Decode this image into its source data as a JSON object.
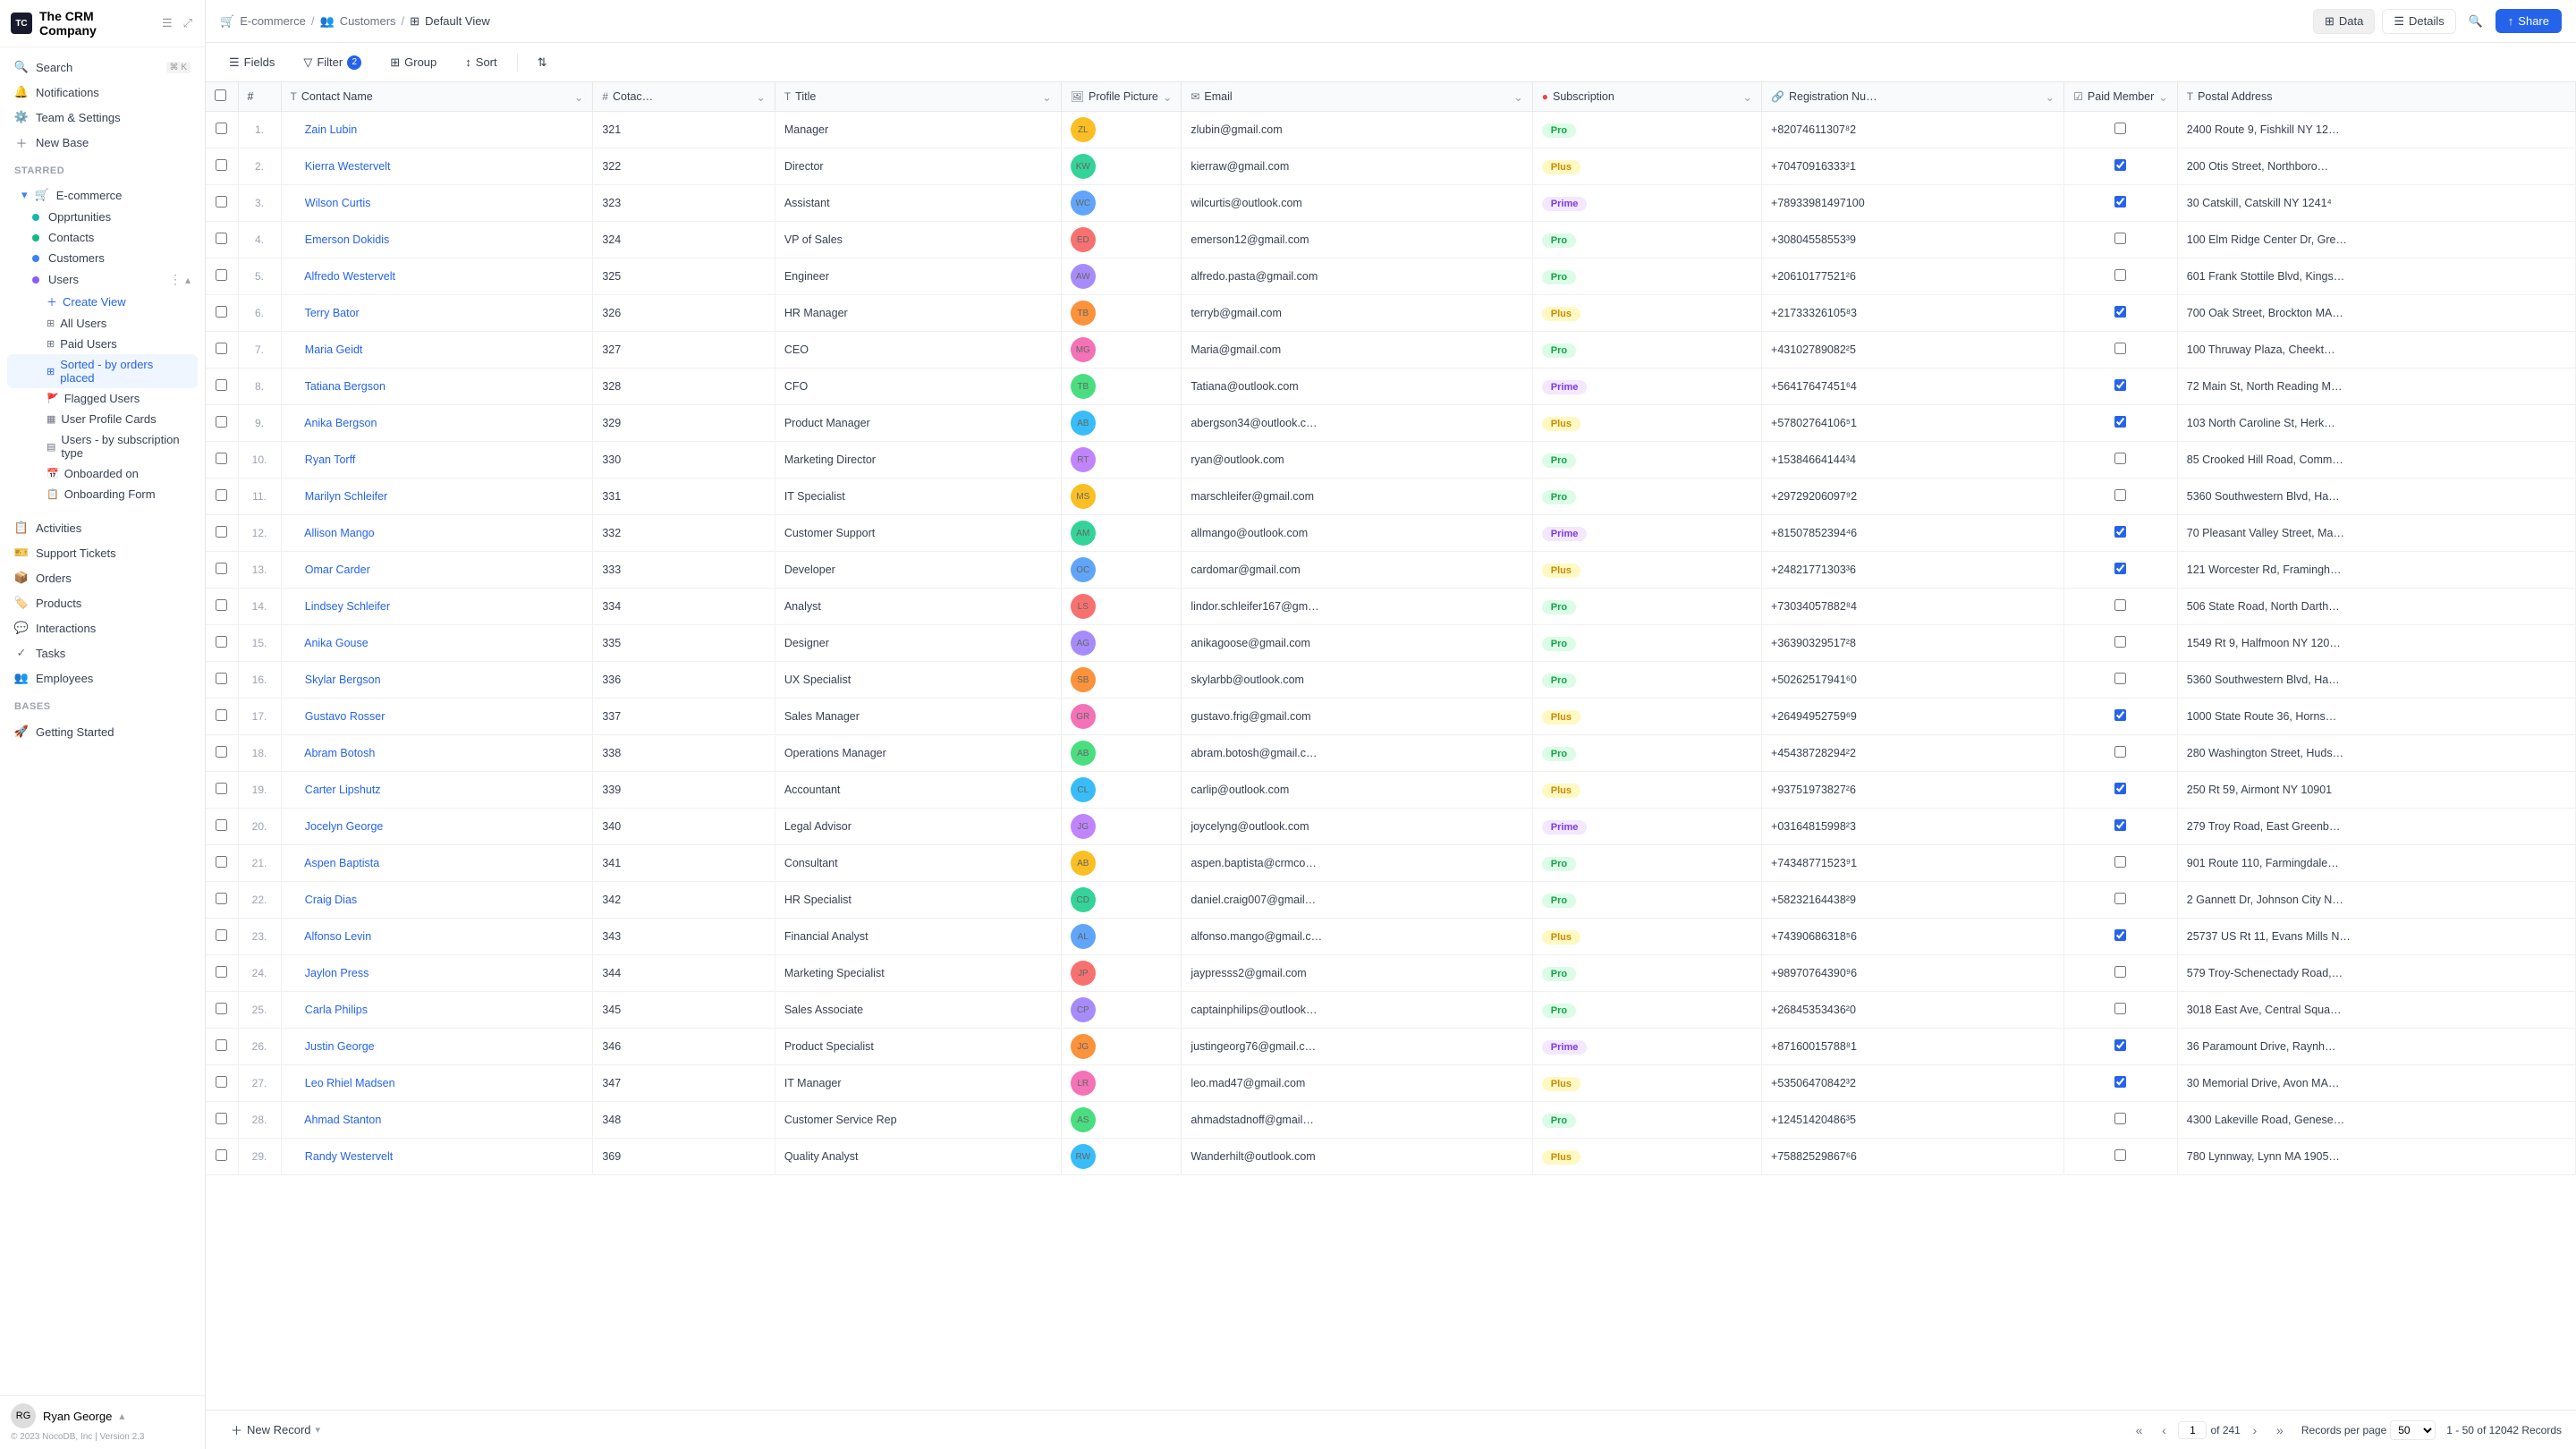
{
  "company": {
    "name": "The CRM Company",
    "logo_text": "TC"
  },
  "sidebar": {
    "top_items": [
      {
        "id": "search",
        "label": "Search",
        "hint": "⌘ K",
        "icon": "🔍"
      },
      {
        "id": "notifications",
        "label": "Notifications",
        "icon": "🔔"
      },
      {
        "id": "team-settings",
        "label": "Team & Settings",
        "icon": "⚙️"
      },
      {
        "id": "new-base",
        "label": "New Base",
        "icon": "+"
      }
    ],
    "starred_label": "Starred",
    "starred_items": [
      {
        "id": "ecommerce",
        "label": "E-commerce",
        "icon": "🛒",
        "dot": "blue"
      }
    ],
    "ecommerce_children": [
      {
        "id": "opportunities",
        "label": "Opprtunities",
        "dot": "teal"
      },
      {
        "id": "contacts",
        "label": "Contacts",
        "dot": "green"
      },
      {
        "id": "customers",
        "label": "Customers",
        "dot": "blue"
      },
      {
        "id": "users",
        "label": "Users",
        "dot": "purple",
        "active": true
      }
    ],
    "users_children": [
      {
        "id": "create-view",
        "label": "Create View"
      },
      {
        "id": "all-users",
        "label": "All Users"
      },
      {
        "id": "paid-users",
        "label": "Paid Users"
      },
      {
        "id": "sorted-by-orders",
        "label": "Sorted - by orders placed",
        "active": true
      },
      {
        "id": "flagged-users",
        "label": "Flagged Users"
      },
      {
        "id": "user-profile-cards",
        "label": "User Profile Cards"
      },
      {
        "id": "users-by-subscription",
        "label": "Users - by subscription type"
      },
      {
        "id": "onboarded-on",
        "label": "Onboarded on"
      },
      {
        "id": "onboarding-form",
        "label": "Onboarding Form"
      }
    ],
    "bottom_items": [
      {
        "id": "activities",
        "label": "Activities",
        "icon": "📋"
      },
      {
        "id": "support-tickets",
        "label": "Support Tickets",
        "icon": "🎫"
      },
      {
        "id": "orders",
        "label": "Orders",
        "icon": "📦"
      },
      {
        "id": "products",
        "label": "Products",
        "icon": "🏷️"
      },
      {
        "id": "interactions",
        "label": "Interactions",
        "icon": "💬"
      },
      {
        "id": "tasks",
        "label": "Tasks",
        "icon": "✓"
      },
      {
        "id": "employees",
        "label": "Employees",
        "icon": "👥"
      }
    ],
    "bases_label": "Bases",
    "bases_items": [
      {
        "id": "getting-started",
        "label": "Getting Started",
        "icon": "🚀"
      }
    ],
    "user": {
      "name": "Ryan George",
      "avatar": "RG"
    },
    "copyright": "© 2023 NocoDB, Inc | Version 2.3"
  },
  "topbar": {
    "breadcrumb": [
      {
        "label": "E-commerce",
        "link": true
      },
      {
        "label": "Customers",
        "link": true
      },
      {
        "label": "Default View",
        "link": false
      }
    ],
    "tabs": [
      {
        "id": "data",
        "label": "Data",
        "active": true
      },
      {
        "id": "details",
        "label": "Details",
        "active": false
      }
    ],
    "share_label": "Share"
  },
  "toolbar": {
    "fields_label": "Fields",
    "filter_label": "Filter",
    "filter_count": "2",
    "group_label": "Group",
    "sort_label": "Sort"
  },
  "table": {
    "columns": [
      {
        "id": "num",
        "label": "#",
        "icon": ""
      },
      {
        "id": "contact-name",
        "label": "Contact Name",
        "icon": "T"
      },
      {
        "id": "cotac",
        "label": "Cotac…",
        "icon": "#"
      },
      {
        "id": "title",
        "label": "Title",
        "icon": "T"
      },
      {
        "id": "profile-picture",
        "label": "Profile Picture",
        "icon": "🖼"
      },
      {
        "id": "email",
        "label": "Email",
        "icon": "✉"
      },
      {
        "id": "subscription",
        "label": "Subscription",
        "icon": "●"
      },
      {
        "id": "registration-nu",
        "label": "Registration Nu…",
        "icon": "🔗"
      },
      {
        "id": "paid-member",
        "label": "Paid Member",
        "icon": "☑"
      },
      {
        "id": "postal-address",
        "label": "Postal Address",
        "icon": "T"
      }
    ],
    "rows": [
      {
        "num": 1,
        "name": "Zain Lubin",
        "cotac": 321,
        "title": "Manager",
        "email": "zlubin@gmail.com",
        "subscription": "Pro",
        "reg": "+82074611307⁸2",
        "paid": false,
        "address": "2400 Route 9, Fishkill NY 12…"
      },
      {
        "num": 2,
        "name": "Kierra Westervelt",
        "cotac": 322,
        "title": "Director",
        "email": "kierraw@gmail.com",
        "subscription": "Plus",
        "reg": "+70470916333²1",
        "paid": true,
        "address": "200 Otis Street, Northboro…"
      },
      {
        "num": 3,
        "name": "Wilson Curtis",
        "cotac": 323,
        "title": "Assistant",
        "email": "wilcurtis@outlook.com",
        "subscription": "Prime",
        "reg": "+78933981497100",
        "paid": true,
        "address": "30 Catskill, Catskill NY 1241⁴"
      },
      {
        "num": 4,
        "name": "Emerson Dokidis",
        "cotac": 324,
        "title": "VP of Sales",
        "email": "emerson12@gmail.com",
        "subscription": "Pro",
        "reg": "+30804558553³9",
        "paid": false,
        "address": "100 Elm Ridge Center Dr, Gre…"
      },
      {
        "num": 5,
        "name": "Alfredo Westervelt",
        "cotac": 325,
        "title": "Engineer",
        "email": "alfredo.pasta@gmail.com",
        "subscription": "Pro",
        "reg": "+20610177521²6",
        "paid": false,
        "address": "601 Frank Stottile Blvd, Kings…"
      },
      {
        "num": 6,
        "name": "Terry Bator",
        "cotac": 326,
        "title": "HR Manager",
        "email": "terryb@gmail.com",
        "subscription": "Plus",
        "reg": "+21733326105⁸3",
        "paid": true,
        "address": "700 Oak Street, Brockton MA…"
      },
      {
        "num": 7,
        "name": "Maria Geidt",
        "cotac": 327,
        "title": "CEO",
        "email": "Maria@gmail.com",
        "subscription": "Pro",
        "reg": "+43102789082²5",
        "paid": false,
        "address": "100 Thruway Plaza, Cheekt…"
      },
      {
        "num": 8,
        "name": "Tatiana Bergson",
        "cotac": 328,
        "title": "CFO",
        "email": "Tatiana@outlook.com",
        "subscription": "Prime",
        "reg": "+56417647451⁶4",
        "paid": true,
        "address": "72 Main St, North Reading M…"
      },
      {
        "num": 9,
        "name": "Anika Bergson",
        "cotac": 329,
        "title": "Product Manager",
        "email": "abergson34@outlook.c…",
        "subscription": "Plus",
        "reg": "+57802764106⁵1",
        "paid": true,
        "address": "103 North Caroline St, Herk…"
      },
      {
        "num": 10,
        "name": "Ryan Torff",
        "cotac": 330,
        "title": "Marketing Director",
        "email": "ryan@outlook.com",
        "subscription": "Pro",
        "reg": "+15384664144³4",
        "paid": false,
        "address": "85 Crooked Hill Road, Comm…"
      },
      {
        "num": 11,
        "name": "Marilyn Schleifer",
        "cotac": 331,
        "title": "IT Specialist",
        "email": "marschleifer@gmail.com",
        "subscription": "Pro",
        "reg": "+29729206097⁹2",
        "paid": false,
        "address": "5360 Southwestern Blvd, Ha…"
      },
      {
        "num": 12,
        "name": "Allison Mango",
        "cotac": 332,
        "title": "Customer Support",
        "email": "allmango@outlook.com",
        "subscription": "Prime",
        "reg": "+81507852394⁴6",
        "paid": true,
        "address": "70 Pleasant Valley Street, Ma…"
      },
      {
        "num": 13,
        "name": "Omar Carder",
        "cotac": 333,
        "title": "Developer",
        "email": "cardomar@gmail.com",
        "subscription": "Plus",
        "reg": "+24821771303³6",
        "paid": true,
        "address": "121 Worcester Rd, Framingh…"
      },
      {
        "num": 14,
        "name": "Lindsey Schleifer",
        "cotac": 334,
        "title": "Analyst",
        "email": "lindor.schleifer167@gm…",
        "subscription": "Pro",
        "reg": "+73034057882⁸4",
        "paid": false,
        "address": "506 State Road, North Darth…"
      },
      {
        "num": 15,
        "name": "Anika Gouse",
        "cotac": 335,
        "title": "Designer",
        "email": "anikagoose@gmail.com",
        "subscription": "Pro",
        "reg": "+36390329517²8",
        "paid": false,
        "address": "1549 Rt 9, Halfmoon NY 120…"
      },
      {
        "num": 16,
        "name": "Skylar Bergson",
        "cotac": 336,
        "title": "UX Specialist",
        "email": "skylarbb@outlook.com",
        "subscription": "Pro",
        "reg": "+50262517941⁶0",
        "paid": false,
        "address": "5360 Southwestern Blvd, Ha…"
      },
      {
        "num": 17,
        "name": "Gustavo Rosser",
        "cotac": 337,
        "title": "Sales Manager",
        "email": "gustavo.frig@gmail.com",
        "subscription": "Plus",
        "reg": "+26494952759⁶9",
        "paid": true,
        "address": "1000 State Route 36, Horns…"
      },
      {
        "num": 18,
        "name": "Abram Botosh",
        "cotac": 338,
        "title": "Operations Manager",
        "email": "abram.botosh@gmail.c…",
        "subscription": "Pro",
        "reg": "+45438728294²2",
        "paid": false,
        "address": "280 Washington Street, Huds…"
      },
      {
        "num": 19,
        "name": "Carter Lipshutz",
        "cotac": 339,
        "title": "Accountant",
        "email": "carlip@outlook.com",
        "subscription": "Plus",
        "reg": "+93751973827²6",
        "paid": true,
        "address": "250 Rt 59, Airmont NY 10901"
      },
      {
        "num": 20,
        "name": "Jocelyn George",
        "cotac": 340,
        "title": "Legal Advisor",
        "email": "joycelyng@outlook.com",
        "subscription": "Prime",
        "reg": "+03164815998²3",
        "paid": true,
        "address": "279 Troy Road, East Greenb…"
      },
      {
        "num": 21,
        "name": "Aspen Baptista",
        "cotac": 341,
        "title": "Consultant",
        "email": "aspen.baptista@crmco…",
        "subscription": "Pro",
        "reg": "+74348771523⁹1",
        "paid": false,
        "address": "901 Route 110, Farmingdale…"
      },
      {
        "num": 22,
        "name": "Craig Dias",
        "cotac": 342,
        "title": "HR Specialist",
        "email": "daniel.craig007@gmail…",
        "subscription": "Pro",
        "reg": "+58232164438²9",
        "paid": false,
        "address": "2 Gannett Dr, Johnson City N…"
      },
      {
        "num": 23,
        "name": "Alfonso Levin",
        "cotac": 343,
        "title": "Financial Analyst",
        "email": "alfonso.mango@gmail.c…",
        "subscription": "Plus",
        "reg": "+74390686318⁵6",
        "paid": true,
        "address": "25737 US Rt 11, Evans Mills N…"
      },
      {
        "num": 24,
        "name": "Jaylon Press",
        "cotac": 344,
        "title": "Marketing Specialist",
        "email": "jaypresss2@gmail.com",
        "subscription": "Pro",
        "reg": "+98970764390⁹6",
        "paid": false,
        "address": "579 Troy-Schenectady Road,…"
      },
      {
        "num": 25,
        "name": "Carla Philips",
        "cotac": 345,
        "title": "Sales Associate",
        "email": "captainphilips@outlook…",
        "subscription": "Pro",
        "reg": "+26845353436²0",
        "paid": false,
        "address": "3018 East Ave, Central Squa…"
      },
      {
        "num": 26,
        "name": "Justin George",
        "cotac": 346,
        "title": "Product Specialist",
        "email": "justingeorg76@gmail.c…",
        "subscription": "Prime",
        "reg": "+87160015788⁸1",
        "paid": true,
        "address": "36 Paramount Drive, Raynh…"
      },
      {
        "num": 27,
        "name": "Leo Rhiel Madsen",
        "cotac": 347,
        "title": "IT Manager",
        "email": "leo.mad47@gmail.com",
        "subscription": "Plus",
        "reg": "+53506470842³2",
        "paid": true,
        "address": "30 Memorial Drive, Avon MA…"
      },
      {
        "num": 28,
        "name": "Ahmad Stanton",
        "cotac": 348,
        "title": "Customer Service Rep",
        "email": "ahmadstadnoff@gmail…",
        "subscription": "Pro",
        "reg": "+12451420486³5",
        "paid": false,
        "address": "4300 Lakeville Road, Genese…"
      },
      {
        "num": 29,
        "name": "Randy Westervelt",
        "cotac": 369,
        "title": "Quality Analyst",
        "email": "Wanderhilt@outlook.com",
        "subscription": "Plus",
        "reg": "+75882529867⁶6",
        "paid": false,
        "address": "780 Lynnway, Lynn MA 1905…"
      }
    ]
  },
  "footer": {
    "new_record_label": "New Record",
    "page_current": "1",
    "page_total": "of 241",
    "records_per_page": "50",
    "records_info": "1 - 50 of 12042 Records"
  }
}
